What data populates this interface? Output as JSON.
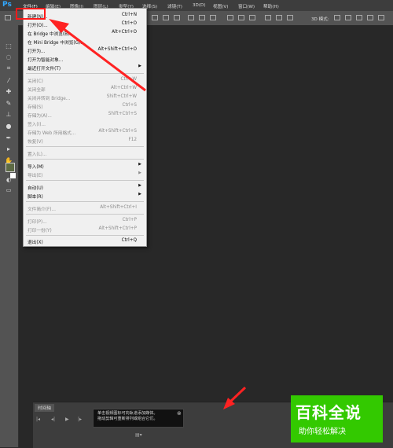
{
  "app": {
    "logo": "Ps"
  },
  "menubar": {
    "items": [
      "文件(F)",
      "编辑(E)",
      "图像(I)",
      "图层(L)",
      "类型(Y)",
      "选择(S)",
      "滤镜(T)",
      "3D(D)",
      "视图(V)",
      "窗口(W)",
      "帮助(H)"
    ]
  },
  "options": {
    "mode_label": "3D 模式:"
  },
  "file_menu": {
    "items": [
      {
        "label": "新建(N)...",
        "shortcut": "Ctrl+N",
        "disabled": false,
        "submenu": false
      },
      {
        "label": "打开(O)...",
        "shortcut": "Ctrl+O",
        "disabled": false,
        "submenu": false
      },
      {
        "label": "在 Bridge 中浏览(B)...",
        "shortcut": "Alt+Ctrl+O",
        "disabled": false,
        "submenu": false
      },
      {
        "label": "在 Mini Bridge 中浏览(G)...",
        "shortcut": "",
        "disabled": false,
        "submenu": false
      },
      {
        "label": "打开为...",
        "shortcut": "Alt+Shift+Ctrl+O",
        "disabled": false,
        "submenu": false
      },
      {
        "label": "打开为智能对象...",
        "shortcut": "",
        "disabled": false,
        "submenu": false
      },
      {
        "label": "最近打开文件(T)",
        "shortcut": "",
        "disabled": false,
        "submenu": true
      },
      {
        "label": "关闭(C)",
        "shortcut": "Ctrl+W",
        "disabled": true,
        "submenu": false
      },
      {
        "label": "关闭全部",
        "shortcut": "Alt+Ctrl+W",
        "disabled": true,
        "submenu": false
      },
      {
        "label": "关闭并转到 Bridge...",
        "shortcut": "Shift+Ctrl+W",
        "disabled": true,
        "submenu": false
      },
      {
        "label": "存储(S)",
        "shortcut": "Ctrl+S",
        "disabled": true,
        "submenu": false
      },
      {
        "label": "存储为(A)...",
        "shortcut": "Shift+Ctrl+S",
        "disabled": true,
        "submenu": false
      },
      {
        "label": "签入(I)...",
        "shortcut": "",
        "disabled": true,
        "submenu": false
      },
      {
        "label": "存储为 Web 所用格式...",
        "shortcut": "Alt+Shift+Ctrl+S",
        "disabled": true,
        "submenu": false
      },
      {
        "label": "恢复(V)",
        "shortcut": "F12",
        "disabled": true,
        "submenu": false
      },
      {
        "label": "置入(L)...",
        "shortcut": "",
        "disabled": true,
        "submenu": false
      },
      {
        "label": "导入(M)",
        "shortcut": "",
        "disabled": false,
        "submenu": true
      },
      {
        "label": "导出(E)",
        "shortcut": "",
        "disabled": true,
        "submenu": true
      },
      {
        "label": "自动(U)",
        "shortcut": "",
        "disabled": false,
        "submenu": true
      },
      {
        "label": "脚本(R)",
        "shortcut": "",
        "disabled": false,
        "submenu": true
      },
      {
        "label": "文件简介(F)...",
        "shortcut": "Alt+Shift+Ctrl+I",
        "disabled": true,
        "submenu": false
      },
      {
        "label": "打印(P)...",
        "shortcut": "Ctrl+P",
        "disabled": true,
        "submenu": false
      },
      {
        "label": "打印一份(Y)",
        "shortcut": "Alt+Shift+Ctrl+P",
        "disabled": true,
        "submenu": false
      },
      {
        "label": "退出(X)",
        "shortcut": "Ctrl+Q",
        "disabled": false,
        "submenu": false
      }
    ]
  },
  "timeline": {
    "tab_label": "时间轴",
    "tooltip_line1": "单击视频图标可向轨道添加媒体。",
    "tooltip_line2": "拖动剪辑可重新排列或组合它们。"
  },
  "watermark": {
    "line1": "百科全说",
    "line2": "助你轻松解决"
  },
  "colors": {
    "accent_red": "#ff1a1a",
    "brand_green": "#33c900"
  }
}
